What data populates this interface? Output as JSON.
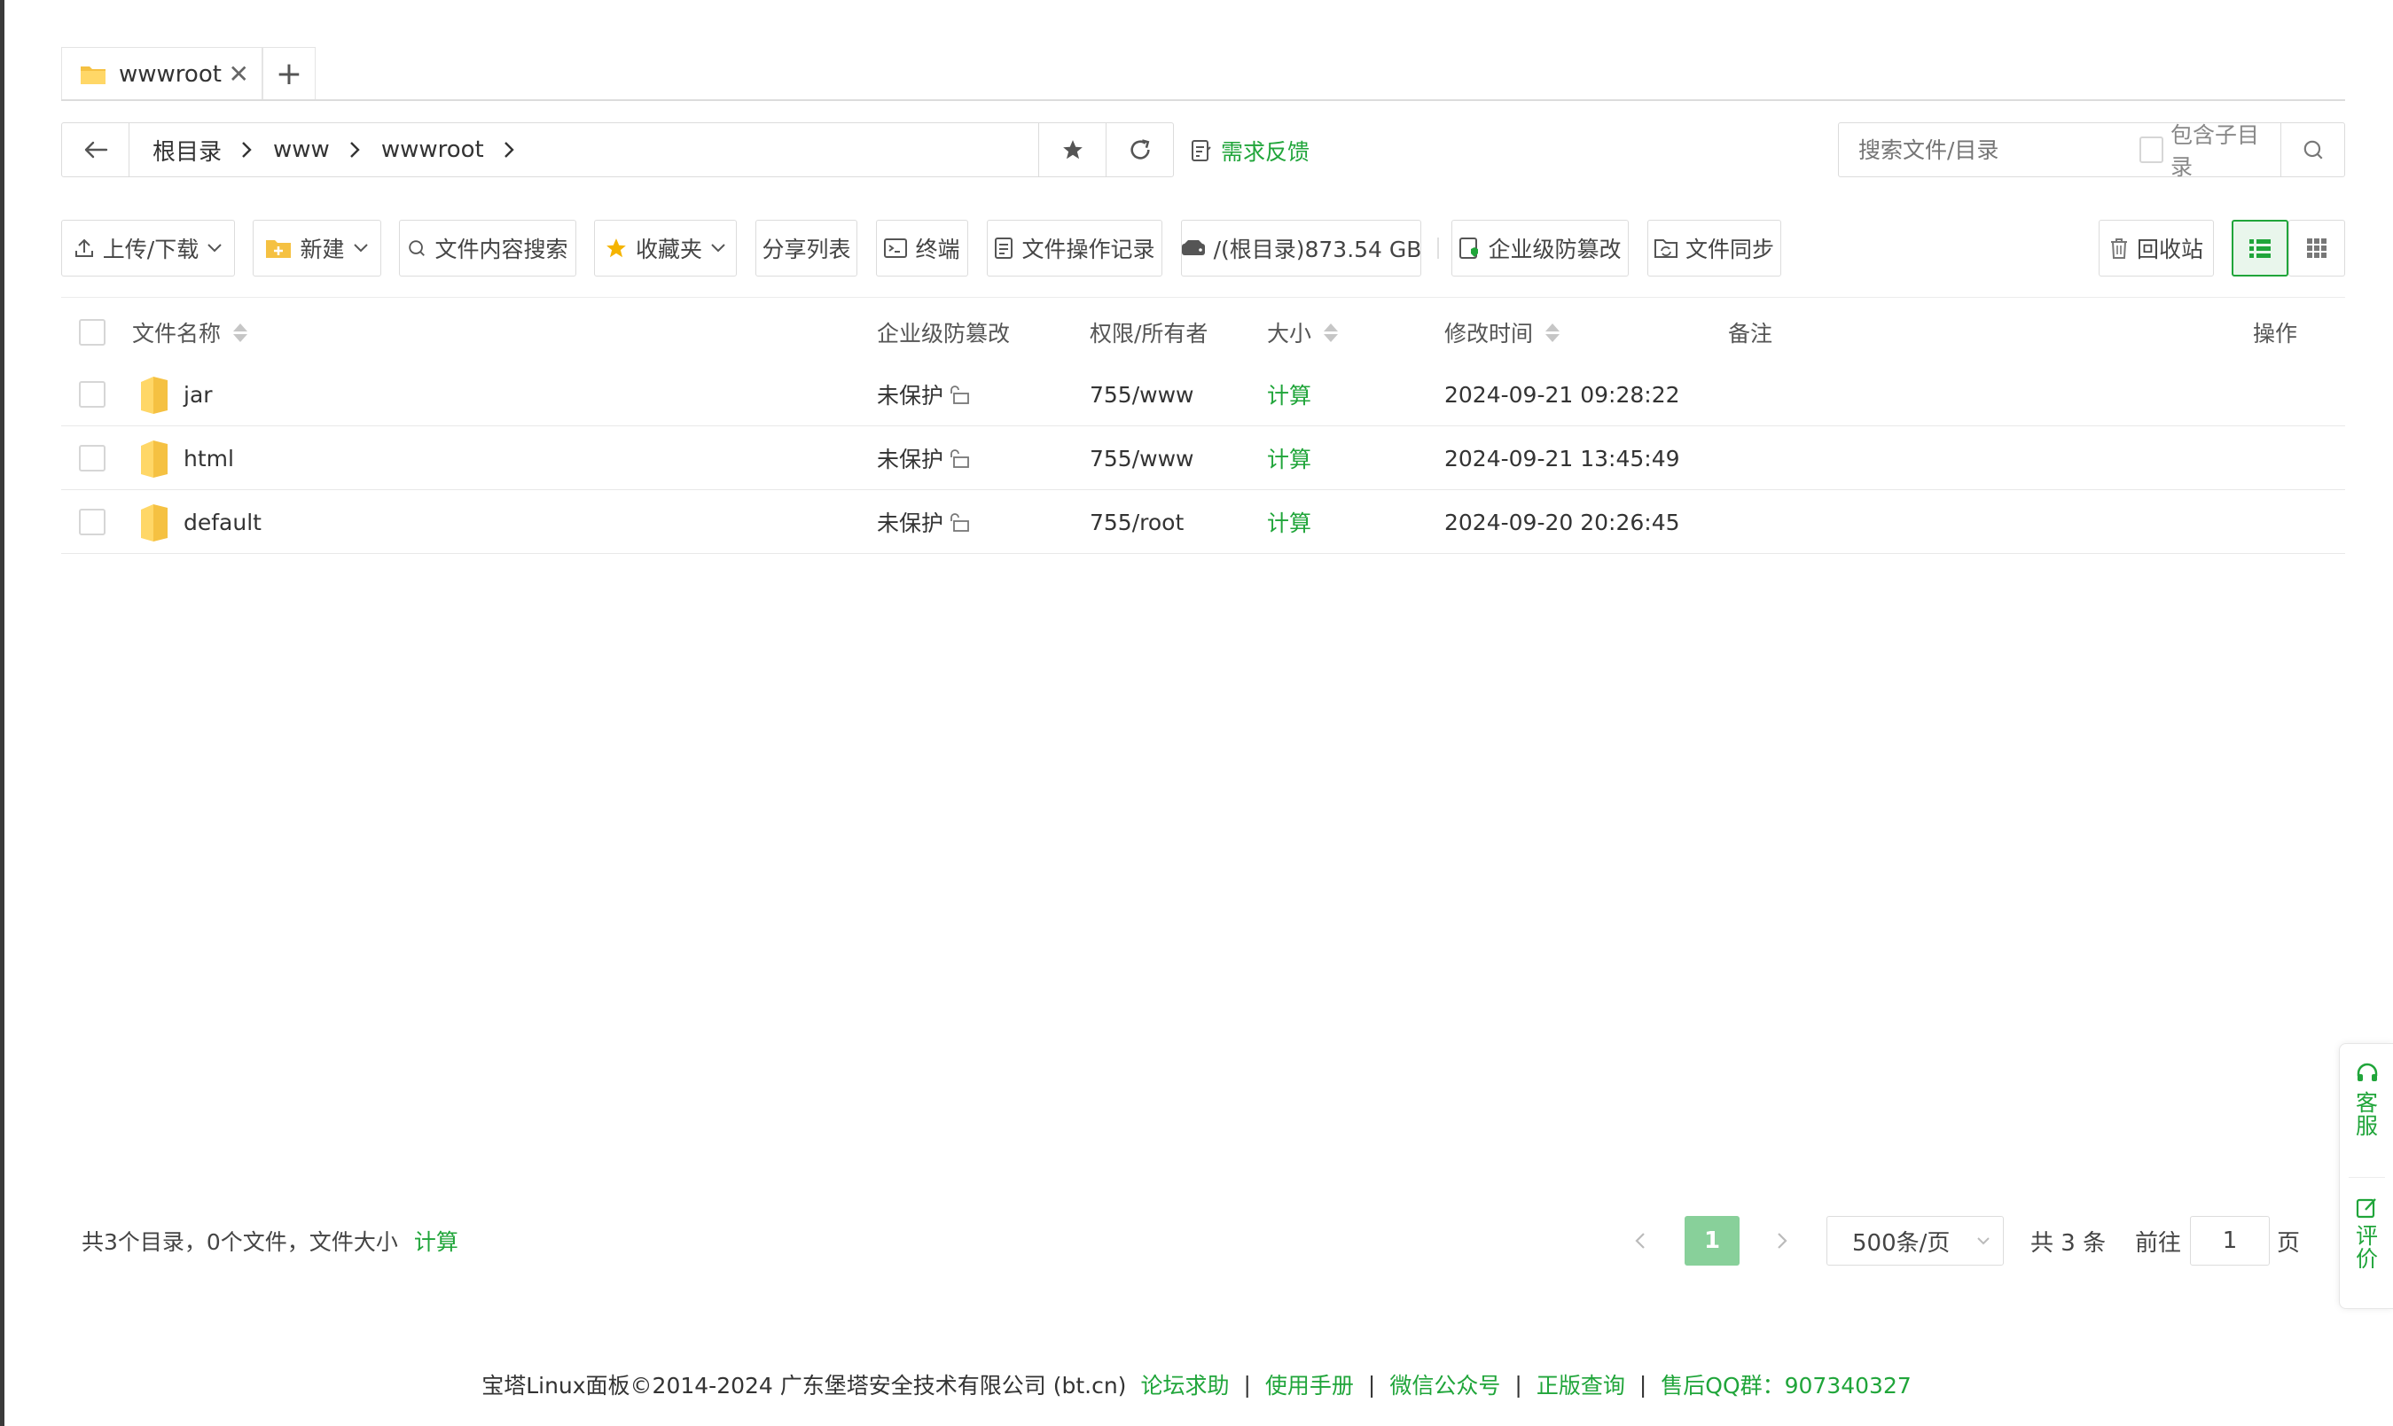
{
  "tabs": [
    {
      "label": "wwwroot",
      "close": "✕"
    }
  ],
  "tab_add": "+",
  "breadcrumbs": [
    "根目录",
    "www",
    "wwwroot"
  ],
  "feedback_label": "需求反馈",
  "search": {
    "placeholder": "搜索文件/目录",
    "subdir_label": "包含子目录"
  },
  "toolbar": {
    "upload": "上传/下载",
    "new": "新建",
    "content_search": "文件内容搜索",
    "favorites": "收藏夹",
    "share_list": "分享列表",
    "terminal": "终端",
    "op_log": "文件操作记录",
    "disk": "/(根目录)873.54 GB",
    "tamper": "企业级防篡改",
    "sync": "文件同步",
    "recycle": "回收站"
  },
  "columns": {
    "name": "文件名称",
    "tamper": "企业级防篡改",
    "perm": "权限/所有者",
    "size": "大小",
    "mtime": "修改时间",
    "remark": "备注",
    "ops": "操作"
  },
  "files": [
    {
      "name": "jar",
      "tamper": "未保护",
      "perm": "755/www",
      "size": "计算",
      "mtime": "2024-09-21 09:28:22"
    },
    {
      "name": "html",
      "tamper": "未保护",
      "perm": "755/www",
      "size": "计算",
      "mtime": "2024-09-21 13:45:49"
    },
    {
      "name": "default",
      "tamper": "未保护",
      "perm": "755/root",
      "size": "计算",
      "mtime": "2024-09-20 20:26:45"
    }
  ],
  "summary": {
    "text": "共3个目录，0个文件，文件大小",
    "calc": "计算"
  },
  "pager": {
    "current": "1",
    "page_size": "500条/页",
    "total": "共 3 条",
    "goto": "前往",
    "goto_value": "1",
    "page_suffix": "页"
  },
  "side": {
    "service": [
      "客",
      "服"
    ],
    "review": [
      "评",
      "价"
    ]
  },
  "footer": {
    "copyright": "宝塔Linux面板©2014-2024 广东堡塔安全技术有限公司 (bt.cn)",
    "links": [
      "论坛求助",
      "使用手册",
      "微信公众号",
      "正版查询",
      "售后QQ群：907340327"
    ],
    "separator": "|"
  },
  "colors": {
    "accent": "#20a53a",
    "folder": "#f5c142",
    "current_page": "#88d09a"
  }
}
